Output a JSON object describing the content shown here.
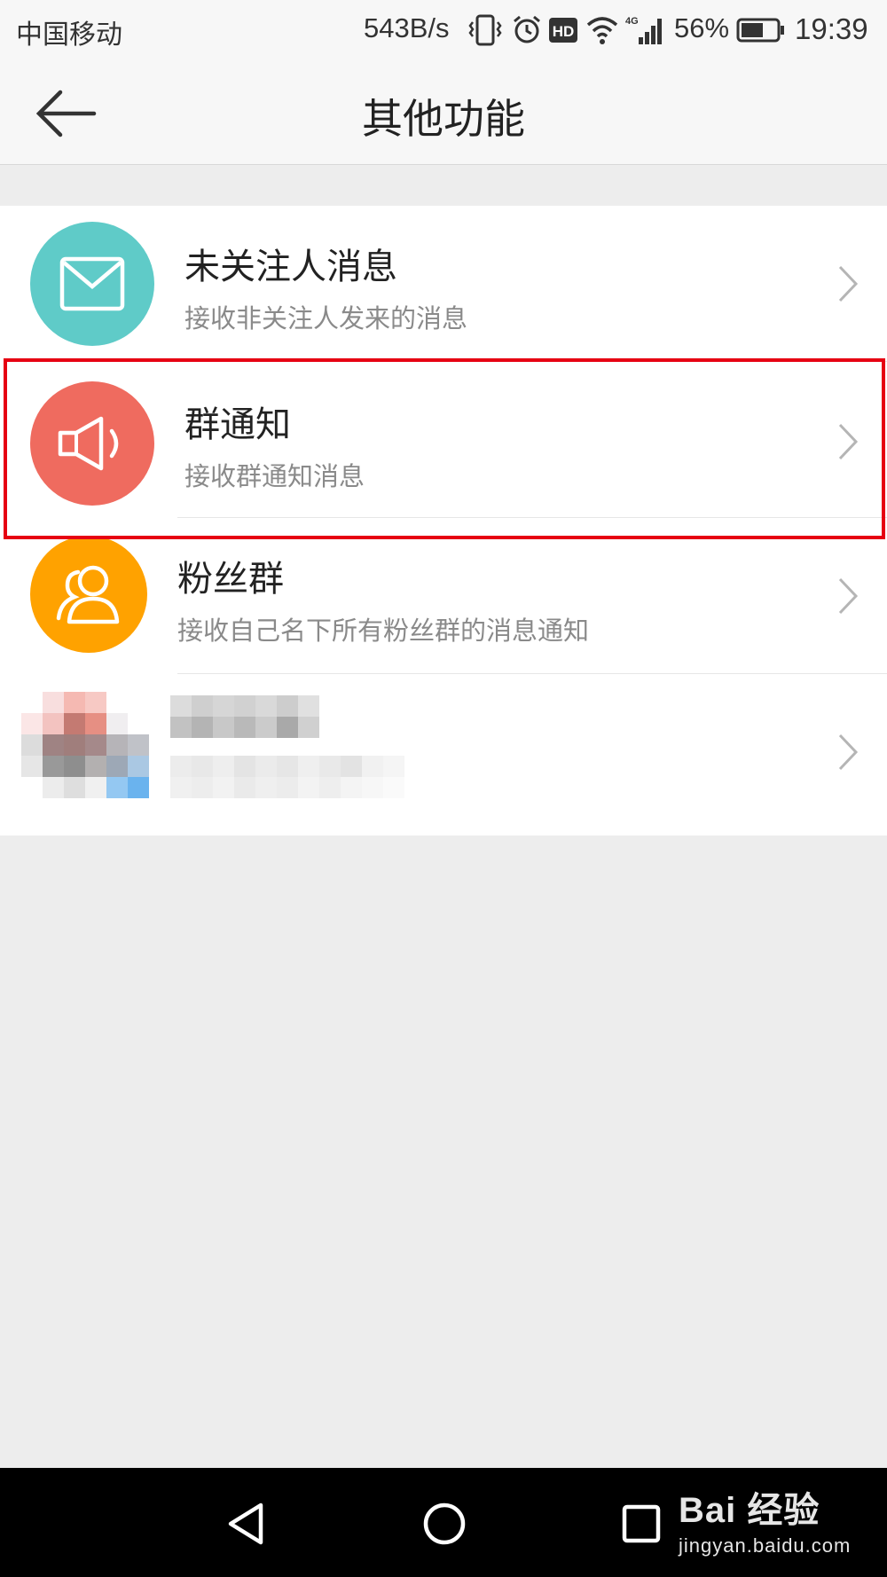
{
  "status_bar": {
    "carrier": "中国移动",
    "net_speed": "543B/s",
    "battery_percent": "56%",
    "time": "19:39",
    "icons": [
      "vibrate-icon",
      "alarm-icon",
      "hd-icon",
      "wifi-icon",
      "4g-signal-icon",
      "battery-icon"
    ]
  },
  "header": {
    "title": "其他功能",
    "back_icon": "back-arrow-icon"
  },
  "items": [
    {
      "title": "未关注人消息",
      "subtitle": "接收非关注人发来的消息",
      "icon": "envelope-icon",
      "icon_color": "#5fcbc8"
    },
    {
      "title": "群通知",
      "subtitle": "接收群通知消息",
      "icon": "speaker-icon",
      "icon_color": "#ef6b5f",
      "highlighted": true
    },
    {
      "title": "粉丝群",
      "subtitle": "接收自己名下所有粉丝群的消息通知",
      "icon": "users-icon",
      "icon_color": "#ffa200"
    },
    {
      "title": "",
      "subtitle": "",
      "icon": "pixelated-avatar",
      "redacted": true
    }
  ],
  "colors": {
    "highlight_border": "#e60012",
    "page_background": "#ededed"
  },
  "system_nav": {
    "buttons": [
      "back-triangle-icon",
      "home-circle-icon",
      "recents-square-icon"
    ]
  },
  "watermark": {
    "brand": "Bai 经验",
    "url": "jingyan.baidu.com"
  }
}
